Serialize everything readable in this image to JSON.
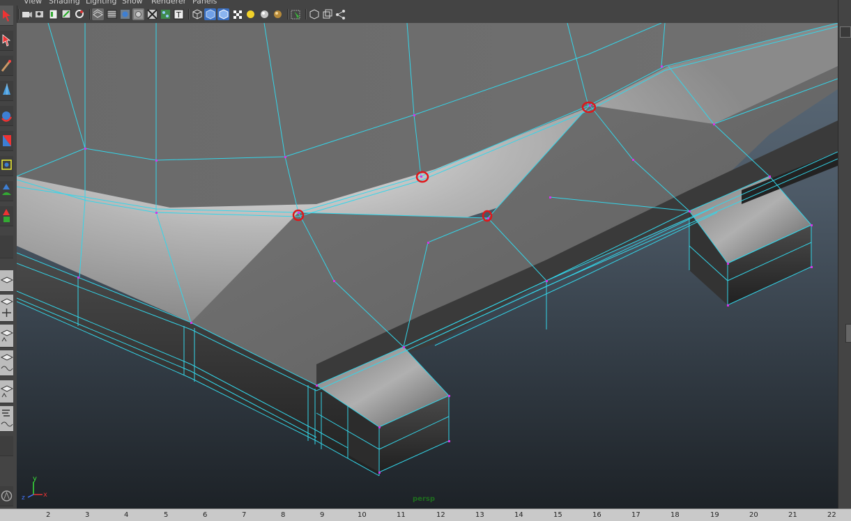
{
  "menubar": {
    "items": [
      "View",
      "Shading",
      "Lighting",
      "Show",
      "Renderer",
      "Panels"
    ]
  },
  "panel_toolbar": {
    "buttons": [
      "camera-attributes-icon",
      "bookmark-icon",
      "image-plane-icon",
      "2d-pan-zoom-icon",
      "grease-pencil-icon",
      "wireframe-icon",
      "smooth-shade-icon",
      "shaded-icon",
      "wireframe-on-shaded-icon",
      "xray-icon",
      "textured-icon",
      "lighting-icon",
      "isolate-select-icon",
      "grid-icon",
      "default-material-icon",
      "textures-icon",
      "shadows-icon",
      "lights-icon",
      "ambient-occlusion-icon",
      "select-camera-icon",
      "display-icon",
      "frame-all-icon",
      "network-icon"
    ]
  },
  "left_toolbar": {
    "tools": [
      "select-tool-icon",
      "lasso-tool-icon",
      "paint-select-icon",
      "move-tool-icon",
      "rotate-tool-icon",
      "scale-tool-icon",
      "universal-manipulator-icon",
      "soft-modify-icon",
      "show-manipulator-icon",
      "last-tool-icon"
    ],
    "layouts": [
      "single-perspective-layout-icon",
      "four-view-layout-icon",
      "persp-outliner-layout-icon",
      "persp-graph-layout-icon",
      "persp-hypershade-layout-icon",
      "outliner-layout-icon"
    ]
  },
  "viewport": {
    "camera_label": "persp",
    "axis": {
      "x": "x",
      "y": "y",
      "z": "z"
    },
    "colors": {
      "wire": "#33d6ea",
      "vertex": "#d633e8",
      "annotation": "#e0161a",
      "background_top": "#5d6c7a",
      "background_bottom": "#1d2227"
    }
  },
  "timeline": {
    "ticks": [
      "2",
      "3",
      "4",
      "5",
      "6",
      "7",
      "8",
      "9",
      "10",
      "11",
      "12",
      "13",
      "14",
      "15",
      "16",
      "17",
      "18",
      "19",
      "20",
      "21",
      "22"
    ]
  }
}
